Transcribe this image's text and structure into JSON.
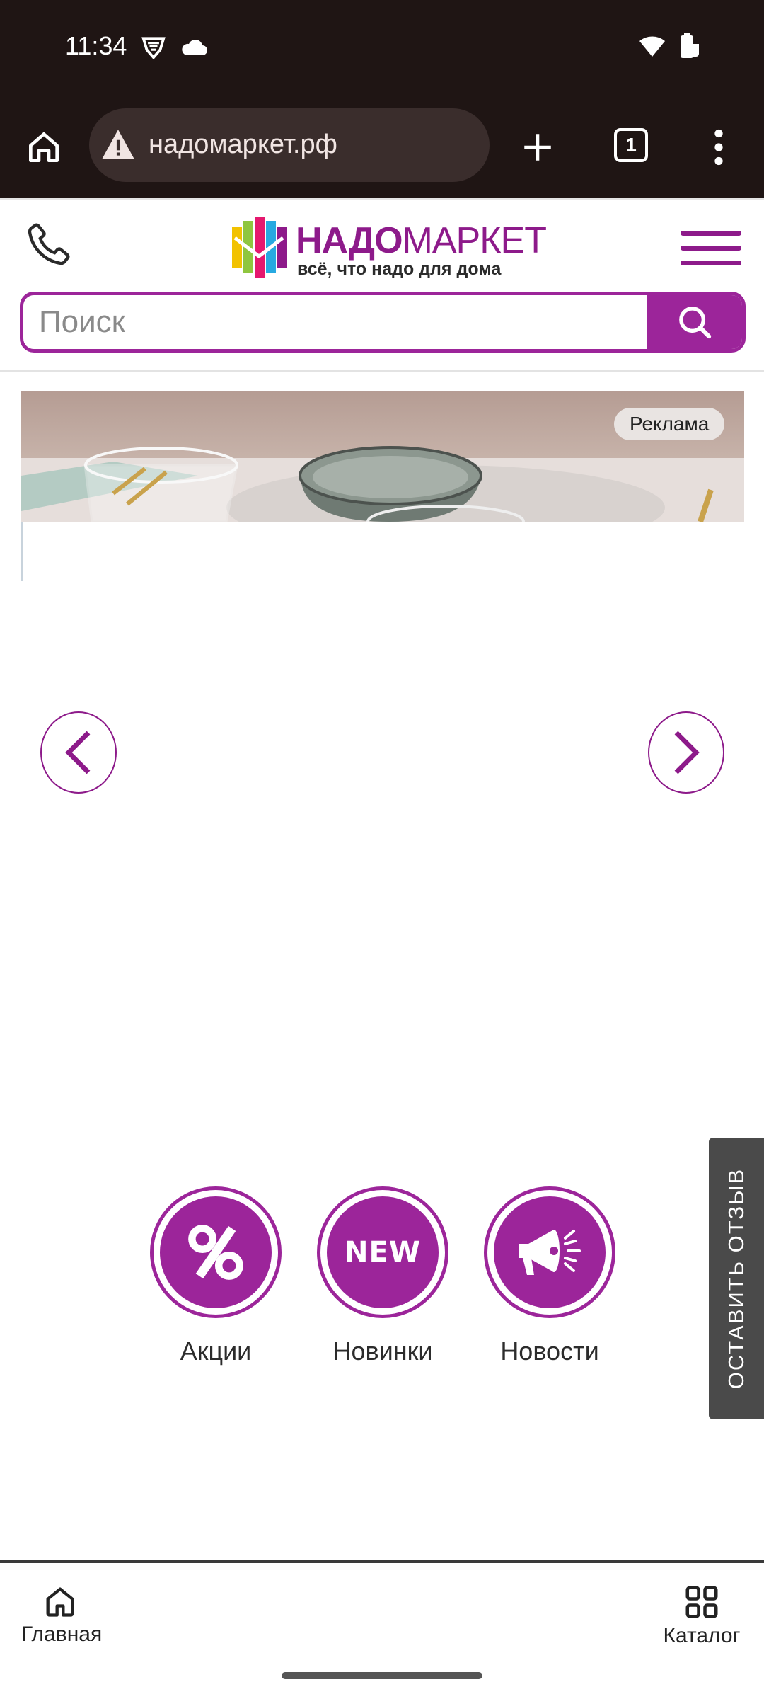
{
  "status_bar": {
    "time": "11:34"
  },
  "browser": {
    "url": "надомаркет.рф",
    "tab_count": "1"
  },
  "header": {
    "logo_bold": "НАДО",
    "logo_rest": "МАРКЕТ",
    "logo_tagline": "всё, что надо для дома",
    "search_placeholder": "Поиск"
  },
  "banner": {
    "ad_label": "Реклама"
  },
  "quick_links": [
    {
      "label": "Акции",
      "icon": "percent-icon"
    },
    {
      "label": "Новинки",
      "icon": "new-badge-icon",
      "icon_text": "NEW"
    },
    {
      "label": "Новости",
      "icon": "megaphone-icon"
    }
  ],
  "feedback": {
    "label": "ОСТАВИТЬ ОТЗЫВ"
  },
  "bottom_nav": {
    "home_label": "Главная",
    "catalog_label": "Каталог"
  },
  "colors": {
    "brand": "#9c259a",
    "browser_bg": "#1f1514"
  }
}
